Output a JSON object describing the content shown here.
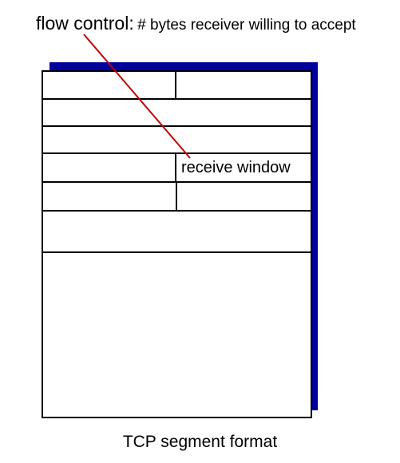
{
  "annotation": {
    "lead": "flow control:",
    "rest": "# bytes receiver willing to accept"
  },
  "segment": {
    "field_label": "receive window"
  },
  "caption": "TCP segment format",
  "colors": {
    "shadow": "#00009c",
    "pointer": "#c00000",
    "lines": "#000000"
  }
}
